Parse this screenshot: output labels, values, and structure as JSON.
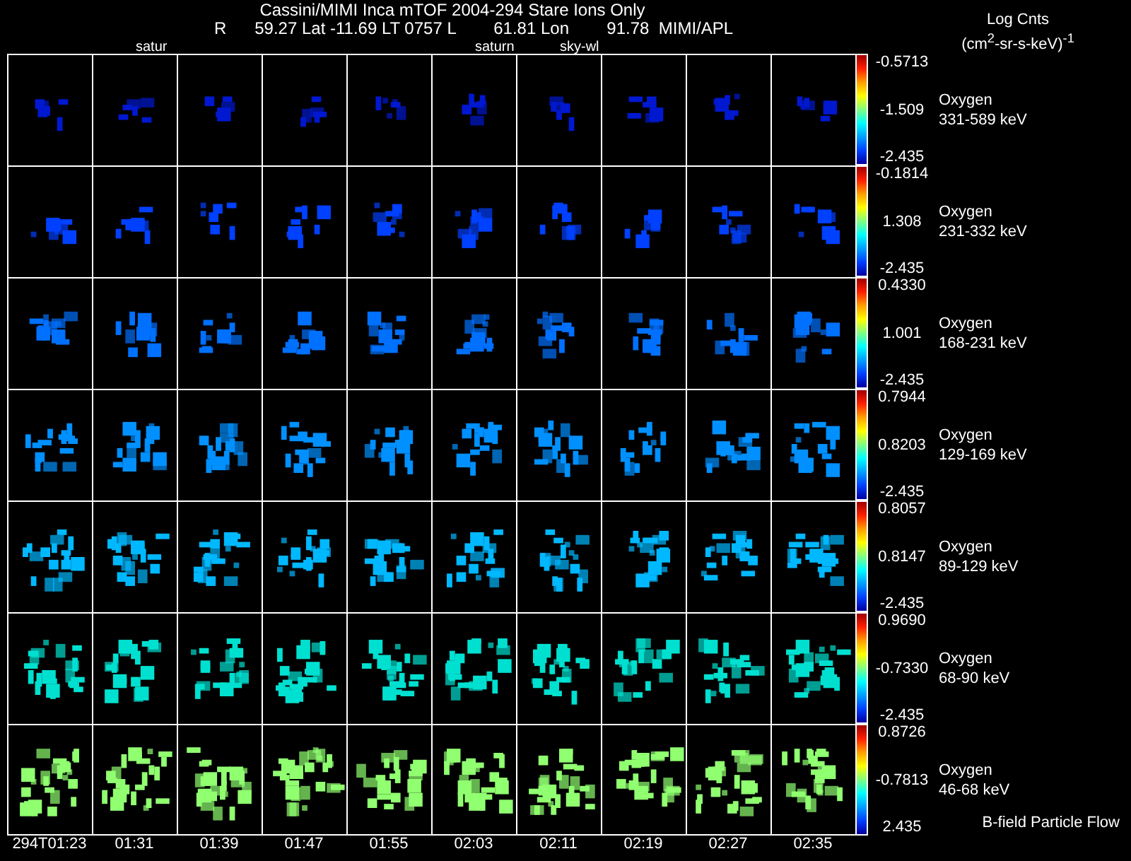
{
  "title": "Cassini/MIMI Inca mTOF  2004-294   Stare   Ions Only",
  "ephemeris": "R      59.27 Lat -11.69 LT 0757 L        61.81 Lon        91.78  MIMI/APL",
  "units": {
    "line1": "Log Cnts",
    "line2": "(cm$^{2}$-sr-s-keV)$^{-1}$"
  },
  "columns": [
    {
      "time": "294T01:23"
    },
    {
      "time": "01:31",
      "marker": "satur"
    },
    {
      "time": "01:39"
    },
    {
      "time": "01:47"
    },
    {
      "time": "01:55"
    },
    {
      "time": "02:03",
      "marker": "saturn"
    },
    {
      "time": "02:11",
      "marker": "sky-wl"
    },
    {
      "time": "02:19"
    },
    {
      "time": "02:27"
    },
    {
      "time": "02:35"
    }
  ],
  "rows": [
    {
      "species": "Oxygen",
      "energy": "331-589 keV",
      "max": "-0.5713",
      "mid": "-1.509",
      "min": "-2.435",
      "color": "#0018d0"
    },
    {
      "species": "Oxygen",
      "energy": "231-332 keV",
      "max": "-0.1814",
      "mid": "1.308",
      "min": "-2.435",
      "color": "#0040ff"
    },
    {
      "species": "Oxygen",
      "energy": "168-231 keV",
      "max": "0.4330",
      "mid": "1.001",
      "min": "-2.435",
      "color": "#0070ff"
    },
    {
      "species": "Oxygen",
      "energy": "129-169 keV",
      "max": "0.7944",
      "mid": "0.8203",
      "min": "-2.435",
      "color": "#0090ff"
    },
    {
      "species": "Oxygen",
      "energy": "89-129 keV",
      "max": "0.8057",
      "mid": "0.8147",
      "min": "-2.435",
      "color": "#00b8ff"
    },
    {
      "species": "Oxygen",
      "energy": "68-90 keV",
      "max": "0.9690",
      "mid": "-0.7330",
      "min": "-2.435",
      "color": "#00e0d0"
    },
    {
      "species": "Oxygen",
      "energy": "46-68 keV",
      "max": "0.8726",
      "mid": "-0.7813",
      "min": "2.435",
      "color": "#90ff70"
    }
  ],
  "note": "B-field Particle Flow"
}
